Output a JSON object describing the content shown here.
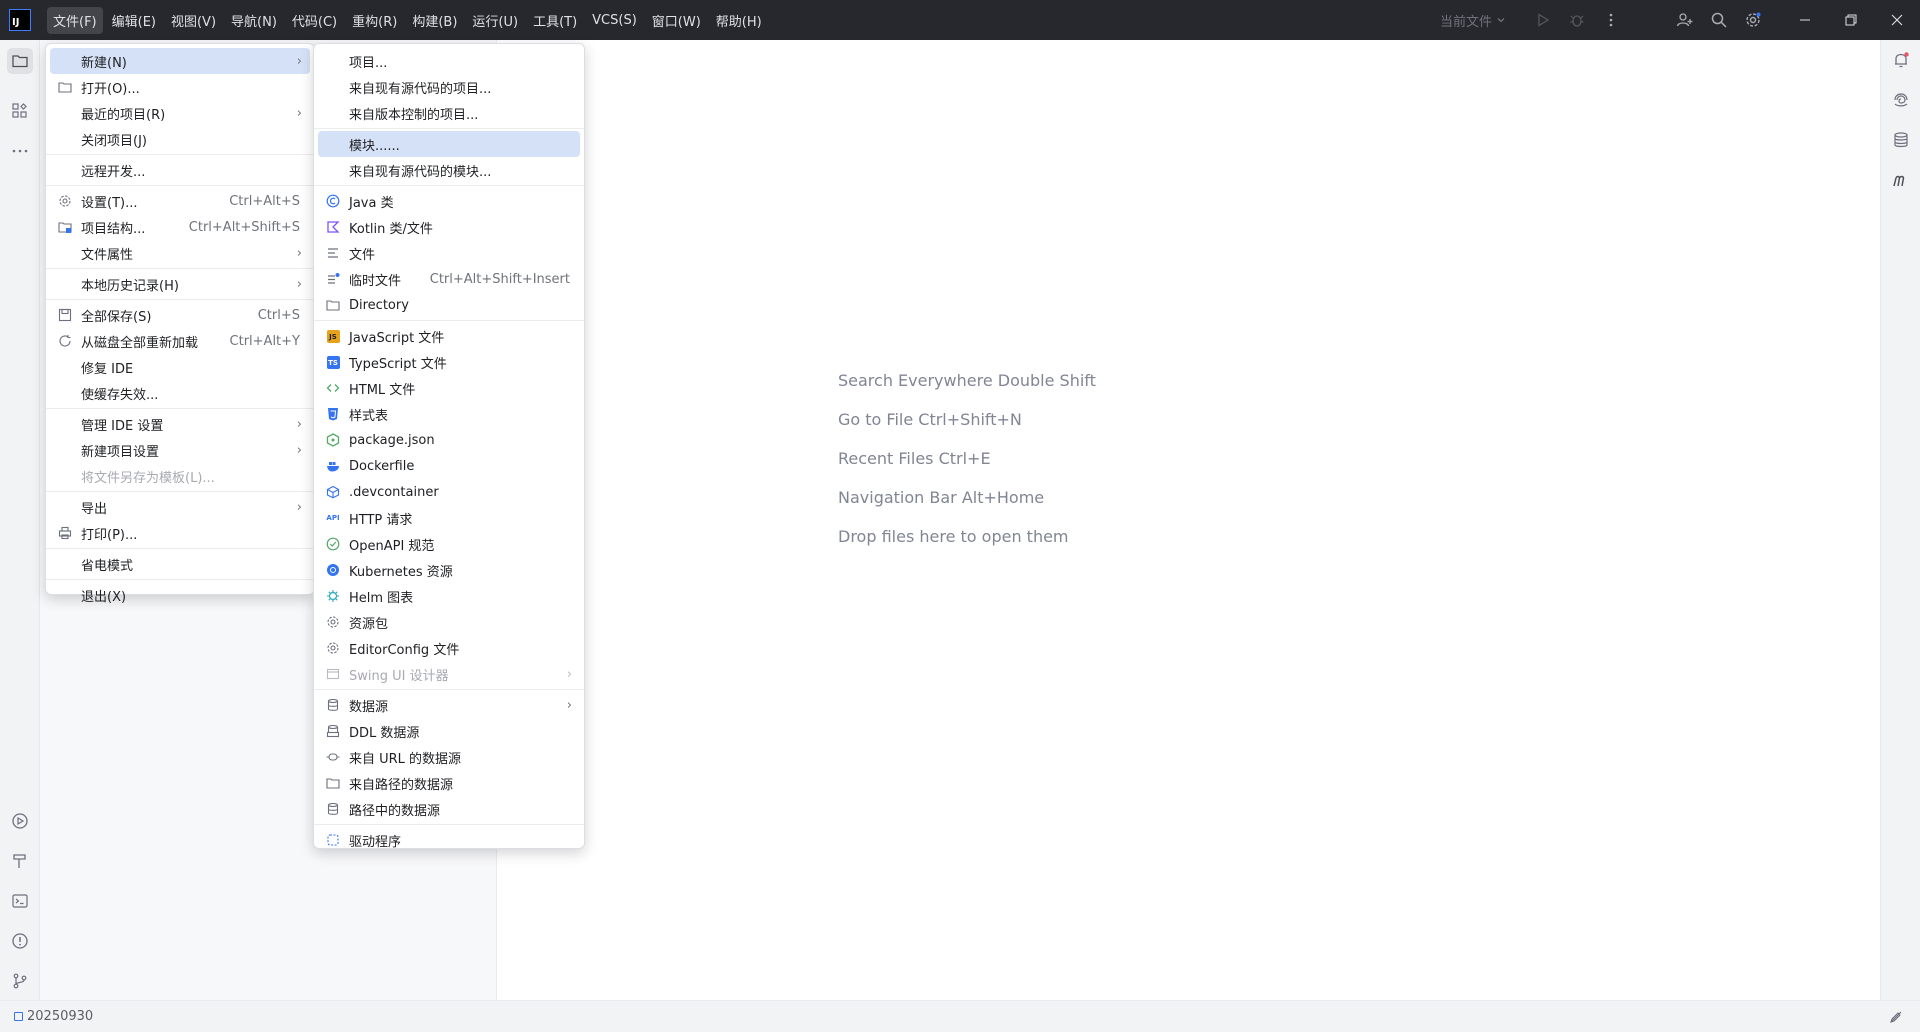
{
  "menubar": {
    "logo": "IJ",
    "items": [
      "文件(F)",
      "编辑(E)",
      "视图(V)",
      "导航(N)",
      "代码(C)",
      "重构(R)",
      "构建(B)",
      "运行(U)",
      "工具(T)",
      "VCS(S)",
      "窗口(W)",
      "帮助(H)"
    ]
  },
  "toolbar": {
    "current_file": "当前文件",
    "icons": [
      "run-icon",
      "debug-icon",
      "more-vertical-icon",
      "add-user-icon",
      "search-icon",
      "settings-icon"
    ]
  },
  "editor": {
    "hints": [
      "Search Everywhere Double Shift",
      "Go to File Ctrl+Shift+N",
      "Recent Files Ctrl+E",
      "Navigation Bar Alt+Home",
      "Drop files here to open them"
    ]
  },
  "file_menu": {
    "new": "新建(N)",
    "open": "打开(O)...",
    "recent_projects": "最近的项目(R)",
    "close_project": "关闭项目(J)",
    "remote_dev": "远程开发...",
    "settings": "设置(T)...",
    "settings_shortcut": "Ctrl+Alt+S",
    "project_structure": "项目结构...",
    "project_structure_shortcut": "Ctrl+Alt+Shift+S",
    "file_properties": "文件属性",
    "local_history": "本地历史记录(H)",
    "save_all": "全部保存(S)",
    "save_all_shortcut": "Ctrl+S",
    "reload_all": "从磁盘全部重新加载",
    "reload_all_shortcut": "Ctrl+Alt+Y",
    "repair_ide": "修复 IDE",
    "invalidate_caches": "使缓存失效...",
    "manage_ide_settings": "管理 IDE 设置",
    "new_project_settings": "新建项目设置",
    "save_as_template": "将文件另存为模板(L)...",
    "export": "导出",
    "print": "打印(P)...",
    "power_save": "省电模式",
    "exit": "退出(X)"
  },
  "new_menu": {
    "project": "项目...",
    "project_from_sources": "来自现有源代码的项目...",
    "project_from_vcs": "来自版本控制的项目...",
    "module": "模块......",
    "module_from_sources": "来自现有源代码的模块...",
    "java_class": "Java 类",
    "kotlin_file": "Kotlin 类/文件",
    "file": "文件",
    "scratch_file": "临时文件",
    "scratch_shortcut": "Ctrl+Alt+Shift+Insert",
    "directory": "Directory",
    "javascript_file": "JavaScript 文件",
    "typescript_file": "TypeScript 文件",
    "html_file": "HTML 文件",
    "stylesheet": "样式表",
    "package_json": "package.json",
    "dockerfile": "Dockerfile",
    "devcontainer": ".devcontainer",
    "http_request": "HTTP 请求",
    "openapi": "OpenAPI 规范",
    "kubernetes": "Kubernetes 资源",
    "helm": "Helm 图表",
    "resource_bundle": "资源包",
    "editorconfig": "EditorConfig 文件",
    "swing_ui": "Swing UI 设计器",
    "data_source": "数据源",
    "ddl_data_source": "DDL 数据源",
    "data_source_url": "来自 URL 的数据源",
    "data_source_path": "来自路径的数据源",
    "data_source_in_path": "路径中的数据源",
    "driver": "驱动程序",
    "badge_js": "JS",
    "badge_ts": "TS",
    "badge_api": "API"
  },
  "statusbar": {
    "project": "20250930"
  },
  "colors": {
    "titlebar": "#27282e",
    "selection": "#d5e1f6",
    "accent": "#3574f0"
  }
}
